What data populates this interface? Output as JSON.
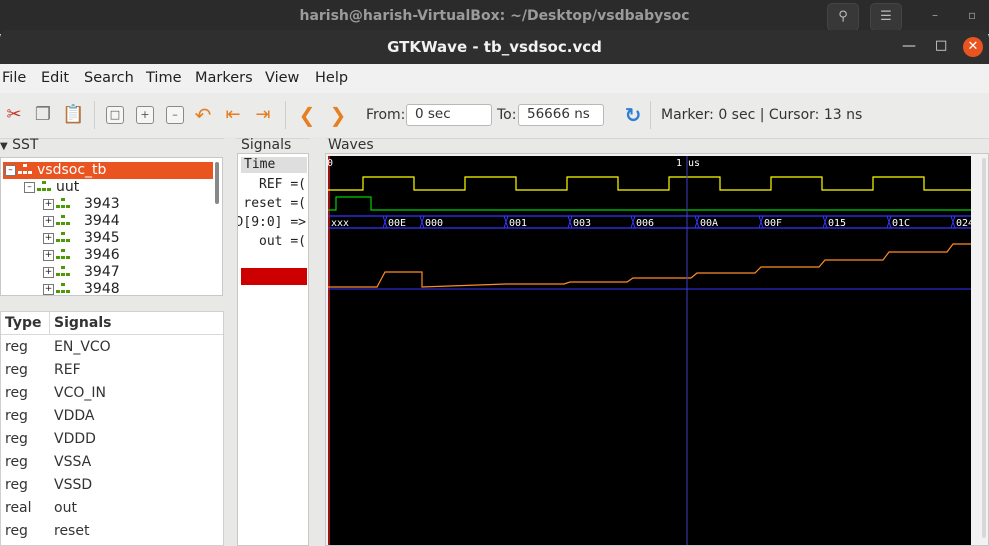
{
  "outer_window": {
    "title": "harish@harish-VirtualBox: ~/Desktop/vsdbabysoc"
  },
  "window": {
    "title": "GTKWave - tb_vsdsoc.vcd"
  },
  "menu": [
    "File",
    "Edit",
    "Search",
    "Time",
    "Markers",
    "View",
    "Help"
  ],
  "toolbar": {
    "from_label": "From:",
    "from_value": "0 sec",
    "to_label": "To:",
    "to_value": "56666 ns",
    "marker_text": "Marker: 0 sec  |  Cursor: 13 ns"
  },
  "sst": {
    "label": "SST",
    "root": "vsdsoc_tb",
    "child": "uut",
    "items": [
      "3943",
      "3944",
      "3945",
      "3946",
      "3947",
      "3948"
    ]
  },
  "signal_list": {
    "headers": [
      "Type",
      "Signals"
    ],
    "rows": [
      {
        "type": "reg",
        "name": "EN_VCO"
      },
      {
        "type": "reg",
        "name": "REF"
      },
      {
        "type": "reg",
        "name": "VCO_IN"
      },
      {
        "type": "reg",
        "name": "VDDA"
      },
      {
        "type": "reg",
        "name": "VDDD"
      },
      {
        "type": "reg",
        "name": "VSSA"
      },
      {
        "type": "reg",
        "name": "VSSD"
      },
      {
        "type": "real",
        "name": "out"
      },
      {
        "type": "reg",
        "name": "reset"
      }
    ]
  },
  "signals_panel": {
    "label": "Signals",
    "time_header": "Time",
    "signals": [
      "REF =(",
      "reset =(",
      "D[9:0] =>",
      "out =("
    ]
  },
  "waves": {
    "label": "Waves",
    "timescale_label": "1 us",
    "ruler_start": "0",
    "d_values": [
      "xxx",
      "00E",
      "000",
      "001",
      "003",
      "006",
      "00A",
      "00F",
      "015",
      "01C",
      "024"
    ],
    "colors": {
      "clock": "#ffff00",
      "reset": "#00d000",
      "bus": "#3535ff",
      "analog": "#ff8c28",
      "cursor": "#4040c0"
    }
  }
}
